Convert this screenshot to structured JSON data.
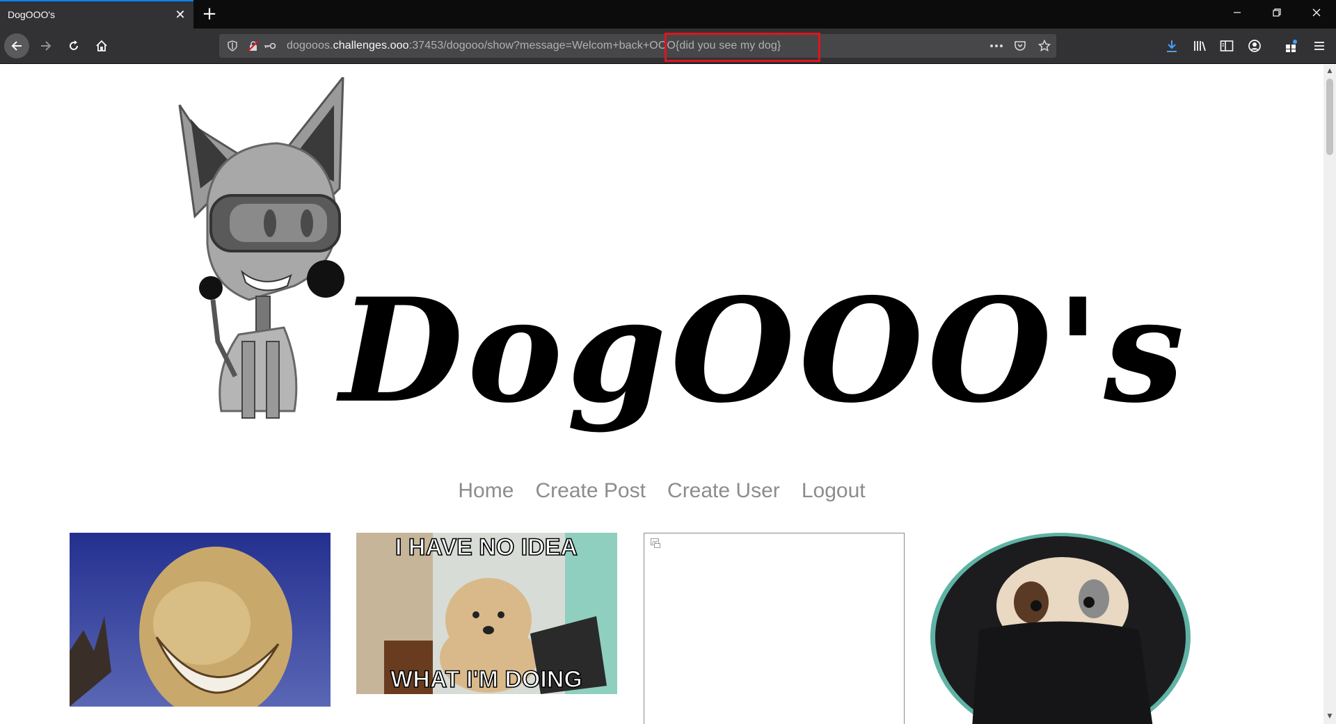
{
  "browser": {
    "tab_title": "DogOOO's",
    "tab_close": "✕",
    "new_tab": "+",
    "url": {
      "prefix": "dogooos.",
      "domain": "challenges.ooo",
      "rest": ":37453/dogooo/show?message=Welcom+back+OOO{did you see my dog}"
    },
    "highlight_color": "#e0141e",
    "accent_color": "#0a84ff"
  },
  "site": {
    "logo_text": "DogOOO's",
    "nav": [
      "Home",
      "Create Post",
      "Create User",
      "Logout"
    ]
  }
}
